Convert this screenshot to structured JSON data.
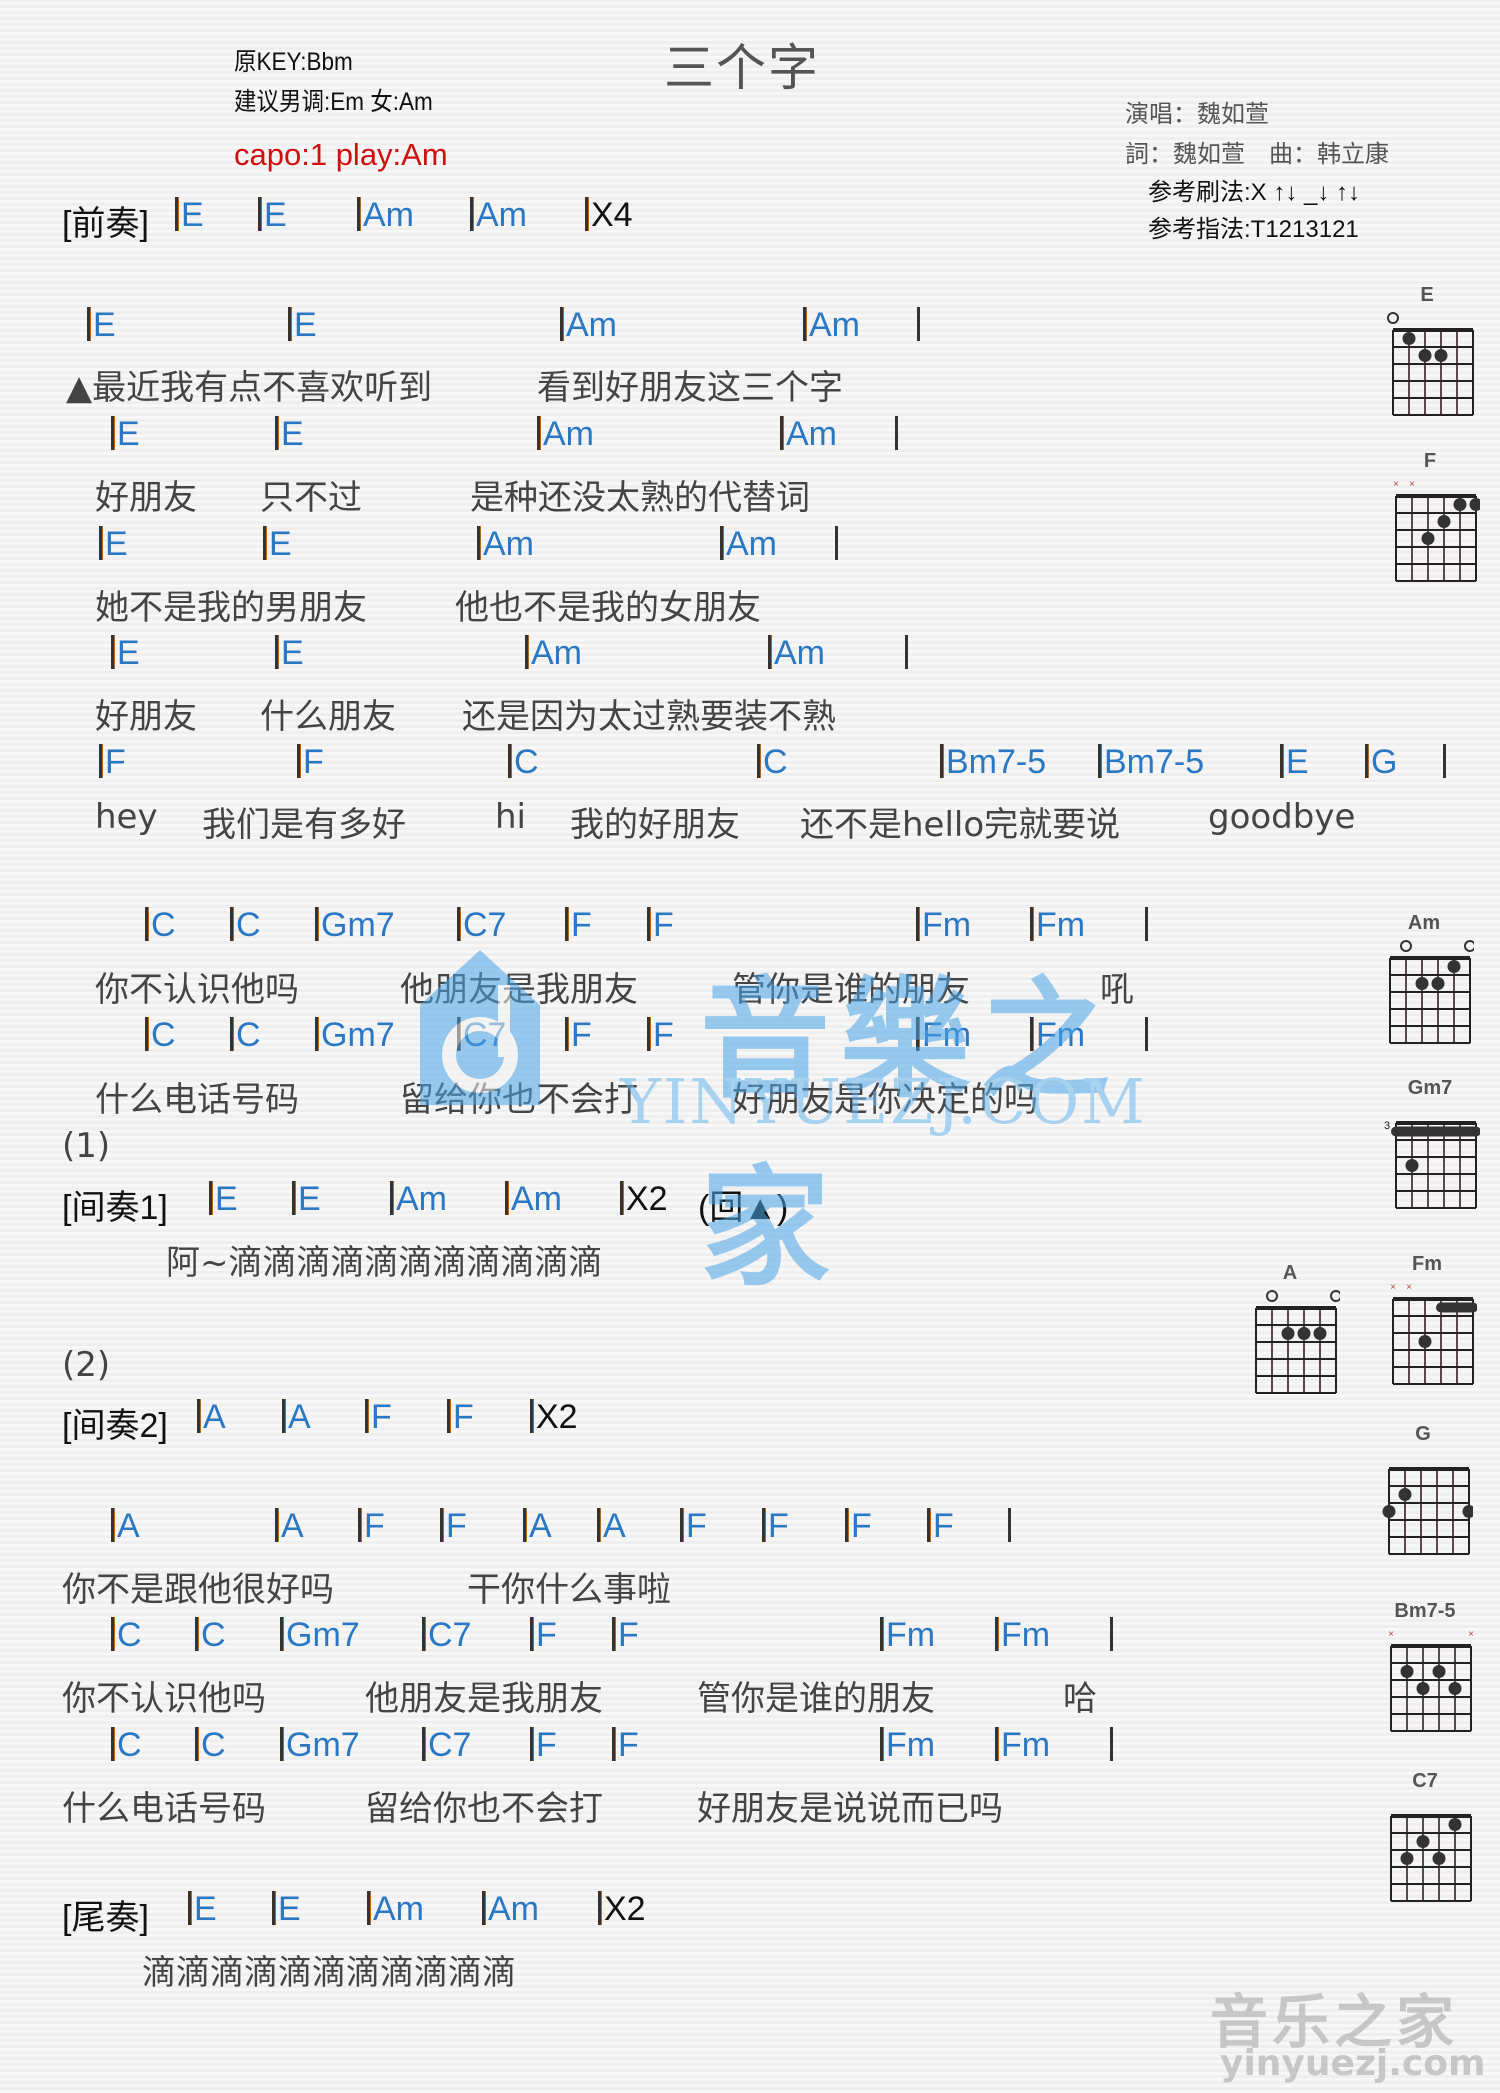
{
  "title": "三个字",
  "meta": {
    "original_key": "原KEY:Bbm",
    "suggested_key": "建议男调:Em 女:Am",
    "capo": "capo:1 play:Am"
  },
  "credits": {
    "singer": "演唱：魏如萱",
    "writers": "詞：魏如萱　曲：韩立康",
    "strum": "参考刷法:X ↑↓ _↓ ↑↓",
    "finger": "参考指法:T1213121"
  },
  "sections": {
    "prelude": {
      "label": "[前奏]",
      "chords": [
        "E",
        "E",
        "Am",
        "Am"
      ],
      "repeat": "X4"
    },
    "interlude1": {
      "label": "[间奏1]",
      "chords": [
        "E",
        "E",
        "Am",
        "Am"
      ],
      "repeat": "X2",
      "note": "(回▲)",
      "lyric": "阿~滴滴滴滴滴滴滴滴滴滴滴"
    },
    "marker1": "(1)",
    "marker2": "(2)",
    "interlude2": {
      "label": "[间奏2]",
      "chords": [
        "A",
        "A",
        "F",
        "F"
      ],
      "repeat": "X2"
    },
    "outro": {
      "label": "[尾奏]",
      "chords": [
        "E",
        "E",
        "Am",
        "Am"
      ],
      "repeat": "X2",
      "lyric": "滴滴滴滴滴滴滴滴滴滴滴"
    }
  },
  "verse": [
    {
      "chords": [
        "E",
        "E",
        "Am",
        "Am"
      ],
      "lyric": [
        "▲最近我有点不喜欢听到",
        "看到好朋友这三个字"
      ]
    },
    {
      "chords": [
        "E",
        "E",
        "Am",
        "Am"
      ],
      "lyric": [
        "好朋友",
        "只不过",
        "是种还没太熟的代替词"
      ]
    },
    {
      "chords": [
        "E",
        "E",
        "Am",
        "Am"
      ],
      "lyric": [
        "她不是我的男朋友",
        "他也不是我的女朋友"
      ]
    },
    {
      "chords": [
        "E",
        "E",
        "Am",
        "Am"
      ],
      "lyric": [
        "好朋友",
        "什么朋友",
        "还是因为太过熟要装不熟"
      ]
    },
    {
      "chords": [
        "F",
        "F",
        "C",
        "C",
        "Bm7-5",
        "Bm7-5",
        "E",
        "G"
      ],
      "lyric": [
        "hey",
        "我们是有多好",
        "hi",
        "我的好朋友",
        "还不是hello完就要说",
        "goodbye"
      ]
    }
  ],
  "chorus1": [
    {
      "chords": [
        "C",
        "C",
        "Gm7",
        "C7",
        "F",
        "F",
        "Fm",
        "Fm"
      ],
      "lyric": [
        "你不认识他吗",
        "他朋友是我朋友",
        "管你是谁的朋友",
        "吼"
      ]
    },
    {
      "chords": [
        "C",
        "C",
        "Gm7",
        "C7",
        "F",
        "F",
        "Fm",
        "Fm"
      ],
      "lyric": [
        "什么电话号码",
        "留给你也不会打",
        "好朋友是你决定的吗"
      ]
    }
  ],
  "bridge": [
    {
      "chords": [
        "A",
        "A",
        "F",
        "F",
        "A",
        "A",
        "F",
        "F",
        "F",
        "F"
      ],
      "lyric": [
        "你不是跟他很好吗",
        "干你什么事啦"
      ]
    },
    {
      "chords": [
        "C",
        "C",
        "Gm7",
        "C7",
        "F",
        "F",
        "Fm",
        "Fm"
      ],
      "lyric": [
        "你不认识他吗",
        "他朋友是我朋友",
        "管你是谁的朋友",
        "哈"
      ]
    },
    {
      "chords": [
        "C",
        "C",
        "Gm7",
        "C7",
        "F",
        "F",
        "Fm",
        "Fm"
      ],
      "lyric": [
        "什么电话号码",
        "留给你也不会打",
        "好朋友是说说而已吗"
      ]
    }
  ],
  "chord_diagrams": [
    {
      "name": "E",
      "markers": "o-----",
      "dots": [
        [
          2,
          1
        ],
        [
          3,
          2
        ],
        [
          4,
          2
        ]
      ],
      "barre": null,
      "fret_label": ""
    },
    {
      "name": "F",
      "markers": "xx----",
      "dots": [
        [
          3,
          3
        ],
        [
          4,
          2
        ],
        [
          5,
          1
        ],
        [
          6,
          1
        ]
      ],
      "barre": null,
      "fret_label": ""
    },
    {
      "name": "Am",
      "markers": "-o---o",
      "dots": [
        [
          3,
          2
        ],
        [
          4,
          2
        ],
        [
          5,
          1
        ]
      ],
      "barre": null,
      "fret_label": ""
    },
    {
      "name": "Gm7",
      "markers": "------",
      "dots": [
        [
          2,
          3
        ]
      ],
      "barre": [
        1,
        6,
        1
      ],
      "fret_label": "3"
    },
    {
      "name": "A",
      "markers": "-o---o",
      "dots": [
        [
          3,
          2
        ],
        [
          4,
          2
        ],
        [
          5,
          2
        ]
      ],
      "barre": null,
      "fret_label": ""
    },
    {
      "name": "Fm",
      "markers": "xx----",
      "dots": [
        [
          3,
          3
        ]
      ],
      "barre": [
        4,
        6,
        1
      ],
      "fret_label": ""
    },
    {
      "name": "G",
      "markers": "------",
      "dots": [
        [
          1,
          3
        ],
        [
          2,
          2
        ],
        [
          6,
          3
        ]
      ],
      "barre": null,
      "fret_label": ""
    },
    {
      "name": "Bm7-5",
      "markers": "x----x",
      "dots": [
        [
          2,
          2
        ],
        [
          3,
          3
        ],
        [
          4,
          2
        ],
        [
          5,
          3
        ]
      ],
      "barre": null,
      "fret_label": ""
    },
    {
      "name": "C7",
      "markers": "------",
      "dots": [
        [
          2,
          3
        ],
        [
          3,
          2
        ],
        [
          4,
          3
        ],
        [
          5,
          1
        ]
      ],
      "barre": null,
      "fret_label": ""
    }
  ],
  "watermark": {
    "brand": "音樂之家",
    "url": "YINYUEZJ.COM",
    "footer_brand": "音乐之家",
    "footer_url": "yinyuezj.com"
  }
}
